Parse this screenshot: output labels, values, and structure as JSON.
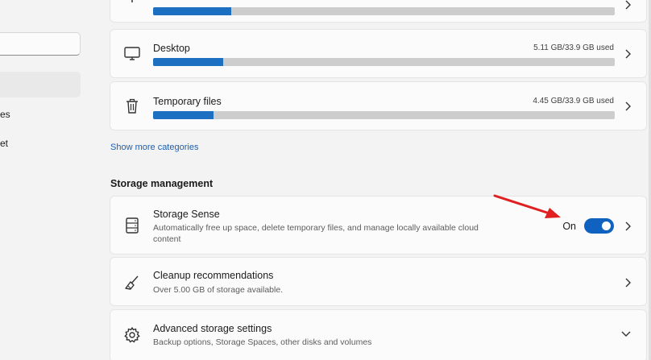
{
  "sidebar": {
    "search_placeholder": "",
    "nav_fragments": [
      "es",
      "et"
    ]
  },
  "categories": [
    {
      "name": "",
      "size_text": "",
      "fill_fraction": 0.17
    },
    {
      "name": "Desktop",
      "size_text": "5.11 GB/33.9 GB used",
      "fill_fraction": 0.151
    },
    {
      "name": "Temporary files",
      "size_text": "4.45 GB/33.9 GB used",
      "fill_fraction": 0.131
    }
  ],
  "show_more_label": "Show more categories",
  "storage_management": {
    "title": "Storage management",
    "storage_sense": {
      "title": "Storage Sense",
      "description": "Automatically free up space, delete temporary files, and manage locally available cloud content",
      "toggle_label": "On",
      "toggle_on": true
    },
    "cleanup": {
      "title": "Cleanup recommendations",
      "description": "Over 5.00 GB of storage available."
    },
    "advanced": {
      "title": "Advanced storage settings",
      "description": "Backup options, Storage Spaces, other disks and volumes"
    }
  },
  "icons": {
    "desktop": "monitor-icon",
    "temp": "trash-icon",
    "storage_sense": "drive-icon",
    "cleanup": "broom-icon",
    "advanced": "gear-icon"
  },
  "colors": {
    "accent": "#0f62c0",
    "bar_fill": "#1d6fc2",
    "arrow": "#e02020"
  }
}
